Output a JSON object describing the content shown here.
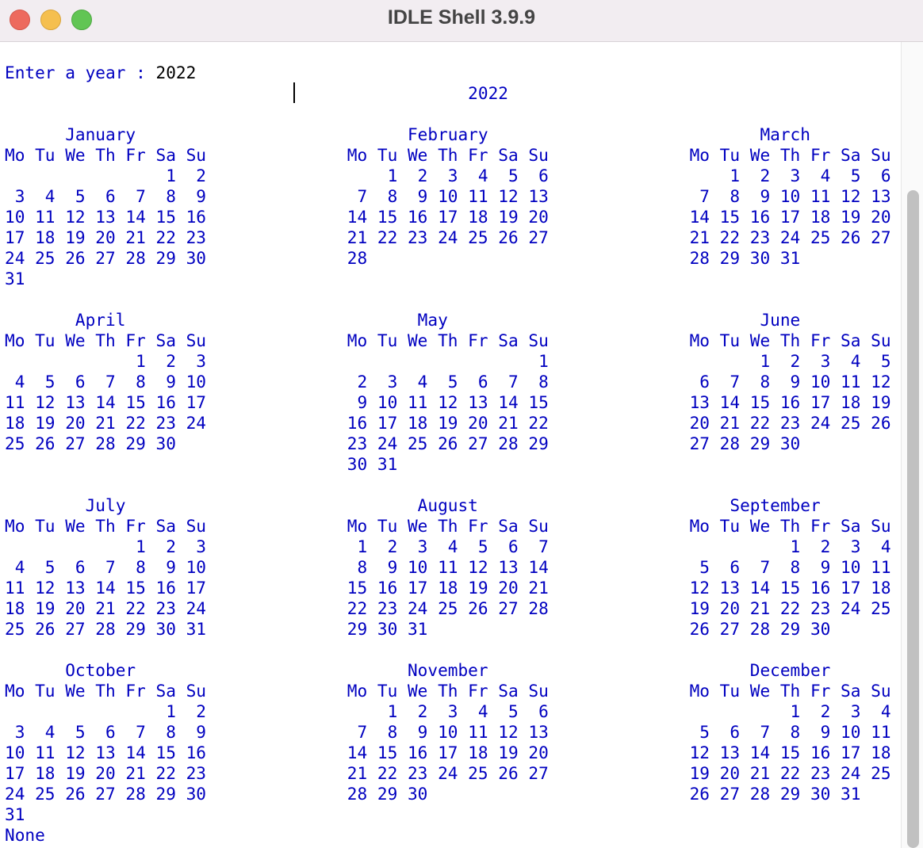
{
  "window": {
    "title": "IDLE Shell 3.9.9",
    "colors": {
      "close": "#ed6a5e",
      "minimize": "#f5bf4f",
      "maximize": "#61c554"
    }
  },
  "shell": {
    "prompt_label": "Enter a year : ",
    "input_value": "2022",
    "output_color": "#0000c0",
    "lines": [
      "                                              2022",
      "",
      "      January                           February                           March",
      "Mo Tu We Th Fr Sa Su              Mo Tu We Th Fr Sa Su              Mo Tu We Th Fr Sa Su",
      "                1  2                  1  2  3  4  5  6                  1  2  3  4  5  6",
      " 3  4  5  6  7  8  9               7  8  9 10 11 12 13               7  8  9 10 11 12 13",
      "10 11 12 13 14 15 16              14 15 16 17 18 19 20              14 15 16 17 18 19 20",
      "17 18 19 20 21 22 23              21 22 23 24 25 26 27              21 22 23 24 25 26 27",
      "24 25 26 27 28 29 30              28                                28 29 30 31",
      "31",
      "",
      "       April                             May                               June",
      "Mo Tu We Th Fr Sa Su              Mo Tu We Th Fr Sa Su              Mo Tu We Th Fr Sa Su",
      "             1  2  3                                 1                     1  2  3  4  5",
      " 4  5  6  7  8  9 10               2  3  4  5  6  7  8               6  7  8  9 10 11 12",
      "11 12 13 14 15 16 17               9 10 11 12 13 14 15              13 14 15 16 17 18 19",
      "18 19 20 21 22 23 24              16 17 18 19 20 21 22              20 21 22 23 24 25 26",
      "25 26 27 28 29 30                 23 24 25 26 27 28 29              27 28 29 30",
      "                                  30 31",
      "",
      "        July                             August                         September",
      "Mo Tu We Th Fr Sa Su              Mo Tu We Th Fr Sa Su              Mo Tu We Th Fr Sa Su",
      "             1  2  3               1  2  3  4  5  6  7                        1  2  3  4",
      " 4  5  6  7  8  9 10               8  9 10 11 12 13 14               5  6  7  8  9 10 11",
      "11 12 13 14 15 16 17              15 16 17 18 19 20 21              12 13 14 15 16 17 18",
      "18 19 20 21 22 23 24              22 23 24 25 26 27 28              19 20 21 22 23 24 25",
      "25 26 27 28 29 30 31              29 30 31                          26 27 28 29 30",
      "",
      "      October                           November                          December",
      "Mo Tu We Th Fr Sa Su              Mo Tu We Th Fr Sa Su              Mo Tu We Th Fr Sa Su",
      "                1  2                  1  2  3  4  5  6                        1  2  3  4",
      " 3  4  5  6  7  8  9               7  8  9 10 11 12 13               5  6  7  8  9 10 11",
      "10 11 12 13 14 15 16              14 15 16 17 18 19 20              12 13 14 15 16 17 18",
      "17 18 19 20 21 22 23              21 22 23 24 25 26 27              19 20 21 22 23 24 25",
      "24 25 26 27 28 29 30              28 29 30                          26 27 28 29 30 31",
      "31",
      "None"
    ]
  }
}
